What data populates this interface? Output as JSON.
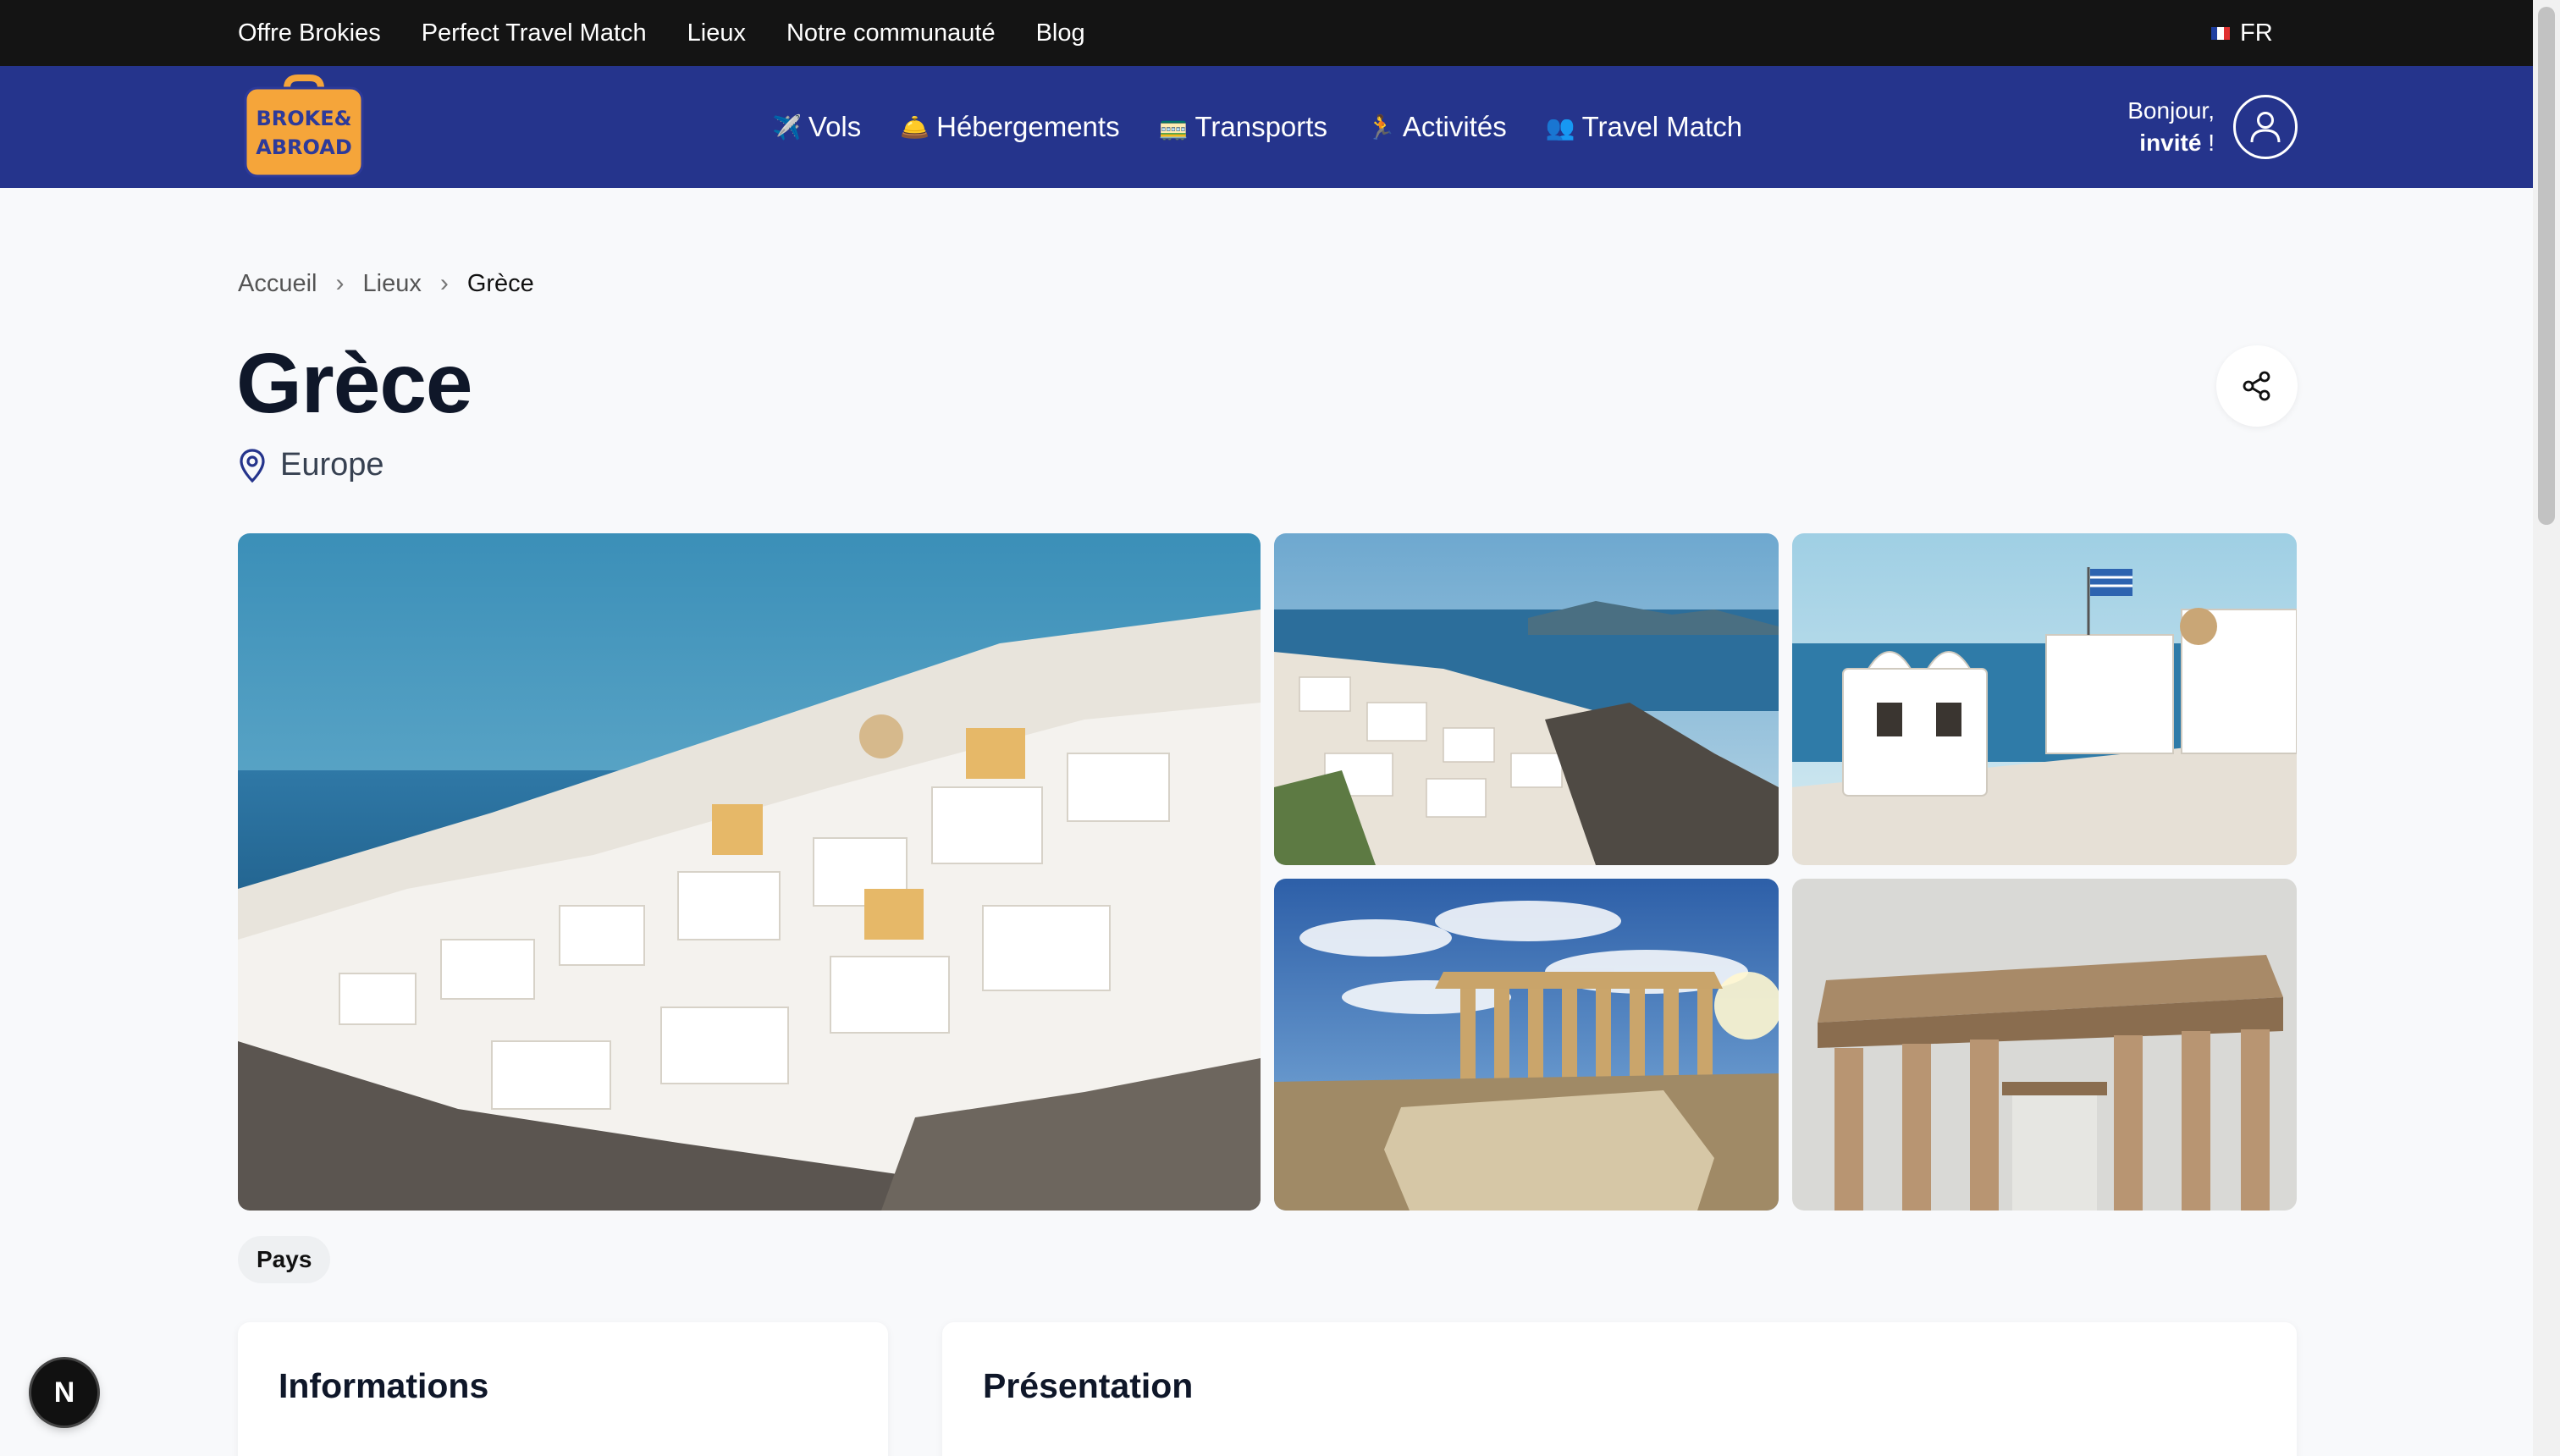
{
  "topbar": {
    "links": [
      "Offre Brokies",
      "Perfect Travel Match",
      "Lieux",
      "Notre communauté",
      "Blog"
    ],
    "language": "FR"
  },
  "nav": {
    "logo_text": [
      "BROKE&",
      "ABROAD"
    ],
    "items": [
      {
        "label": "Vols",
        "icon": "airplane-icon"
      },
      {
        "label": "Hébergements",
        "icon": "bell-icon"
      },
      {
        "label": "Transports",
        "icon": "train-icon"
      },
      {
        "label": "Activités",
        "icon": "runner-icon"
      },
      {
        "label": "Travel Match",
        "icon": "people-icon"
      }
    ],
    "greeting_line1": "Bonjour,",
    "greeting_name": "invité",
    "greeting_suffix": " !"
  },
  "breadcrumb": [
    "Accueil",
    "Lieux",
    "Grèce"
  ],
  "page": {
    "title": "Grèce",
    "region": "Europe",
    "tag": "Pays"
  },
  "cards": {
    "info_title": "Informations",
    "presentation_title": "Présentation"
  },
  "dev_badge": "N",
  "colors": {
    "topbar": "#141414",
    "nav": "#25348c",
    "logo_orange": "#f5a53a",
    "background": "#f8f9fb"
  }
}
